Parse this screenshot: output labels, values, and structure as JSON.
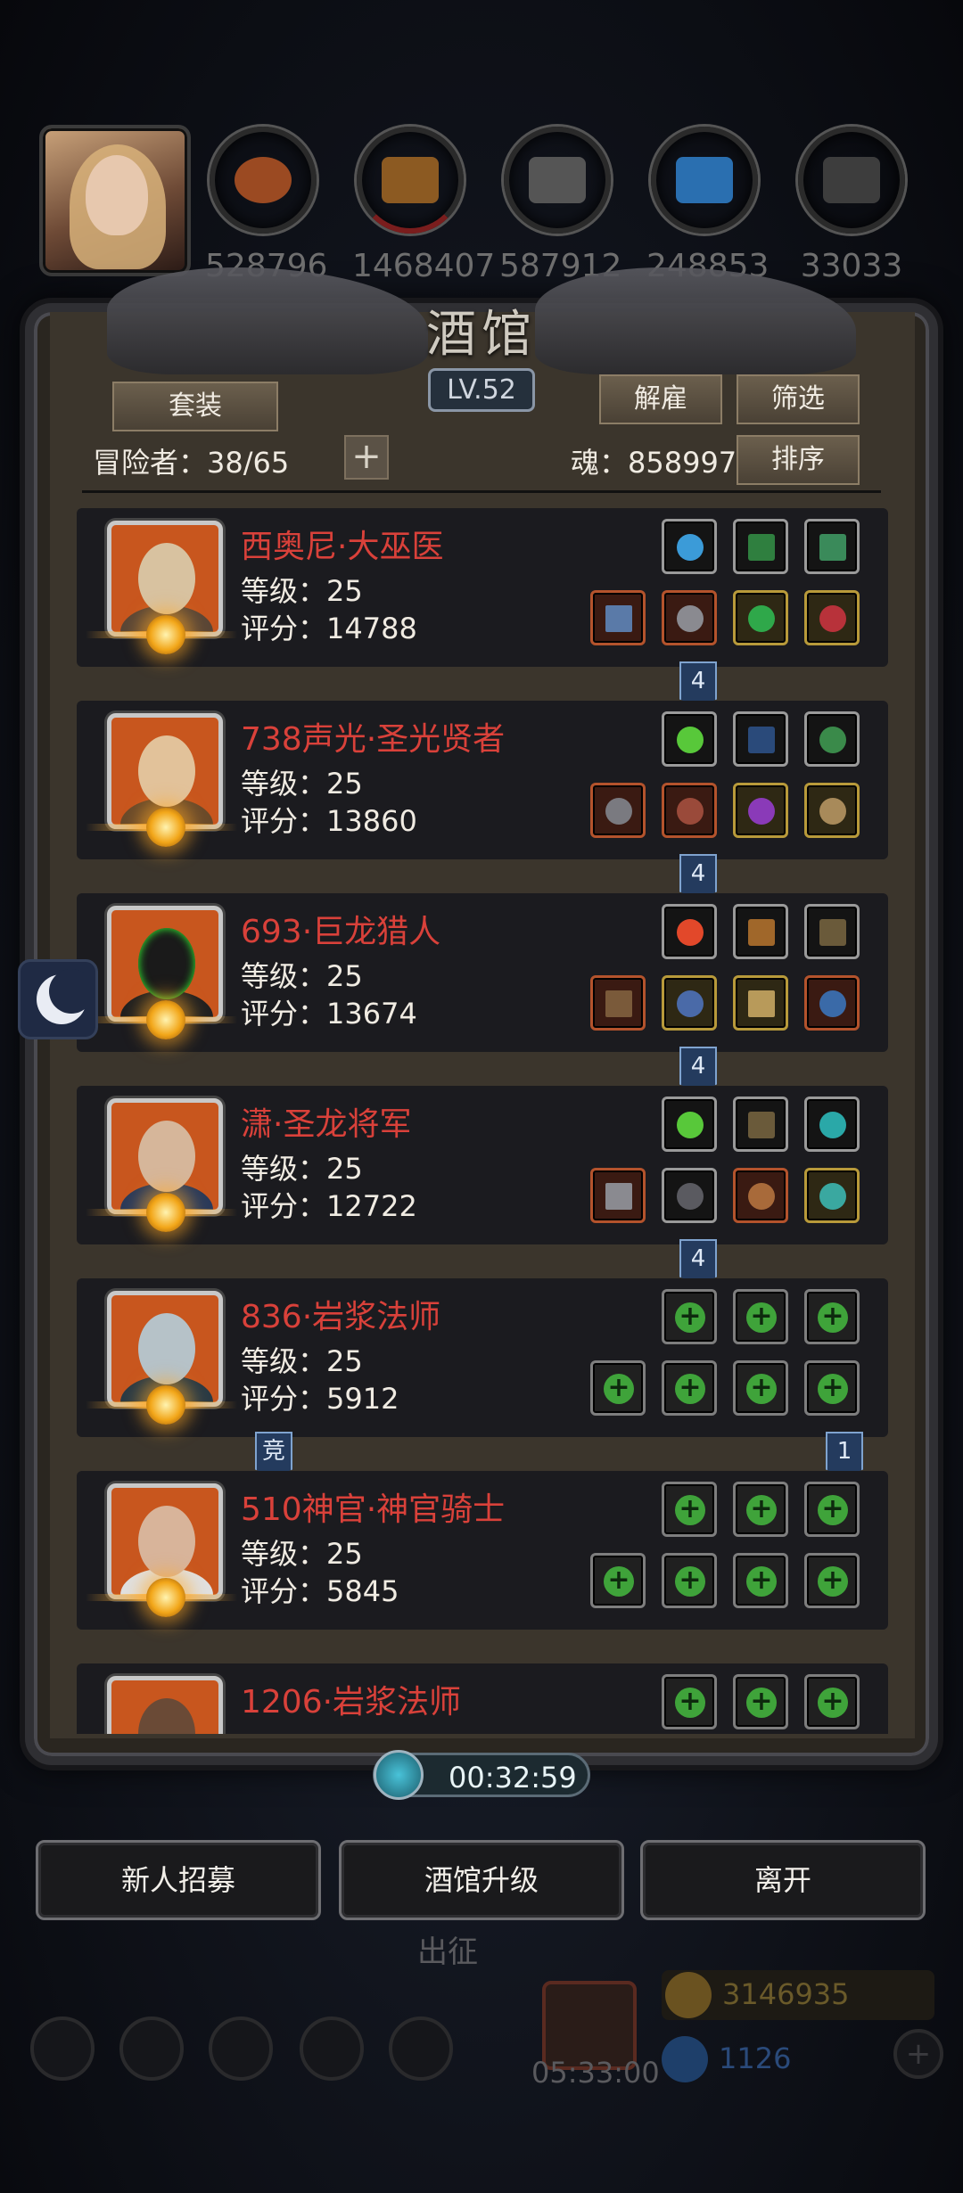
{
  "resources": [
    {
      "icon": "meat-icon",
      "value": "528796",
      "color": "#b35a2a"
    },
    {
      "icon": "wood-icon",
      "value": "1468407",
      "color": "#a0692c"
    },
    {
      "icon": "iron-icon",
      "value": "587912",
      "color": "#6b6b6b"
    },
    {
      "icon": "crystal-icon",
      "value": "248853",
      "color": "#2f7fc8"
    },
    {
      "icon": "ore-icon",
      "value": "33033",
      "color": "#4a4a4a"
    }
  ],
  "tavern": {
    "title": "酒馆",
    "level": "LV.52",
    "suit_button": "套装",
    "dismiss_button": "解雇",
    "filter_button": "筛选",
    "sort_button": "排序",
    "adventurers": "冒险者：38/65",
    "soul": "魂：858997",
    "add_symbol": "+"
  },
  "heroes": [
    {
      "name": "西奥尼·大巫医",
      "level": "等级：25",
      "score": "评分：14788",
      "tag": "4",
      "portrait_color": "#c8561e"
    },
    {
      "name": "738声光·圣光贤者",
      "level": "等级：25",
      "score": "评分：13860",
      "tag": "4",
      "portrait_color": "#c8561e"
    },
    {
      "name": "693·巨龙猎人",
      "level": "等级：25",
      "score": "评分：13674",
      "tag": "4",
      "portrait_color": "#c8561e"
    },
    {
      "name": "潇·圣龙将军",
      "level": "等级：25",
      "score": "评分：12722",
      "tag": "4",
      "portrait_color": "#c8561e"
    },
    {
      "name": "836·岩浆法师",
      "level": "等级：25",
      "score": "评分：5912",
      "tag_left": "竞",
      "tag": "1",
      "portrait_color": "#c8561e"
    },
    {
      "name": "510神官·神官骑士",
      "level": "等级：25",
      "score": "评分：5845",
      "portrait_color": "#c8561e"
    },
    {
      "name": "1206·岩浆法师",
      "level": "",
      "score": "",
      "portrait_color": "#c8561e"
    }
  ],
  "timer": "00:32:59",
  "actions": {
    "recruit": "新人招募",
    "upgrade": "酒馆升级",
    "leave": "离开"
  },
  "background": {
    "expedition": "出征",
    "gift_timer": "05:33:00",
    "gold": "3146935",
    "gems": "1126"
  }
}
